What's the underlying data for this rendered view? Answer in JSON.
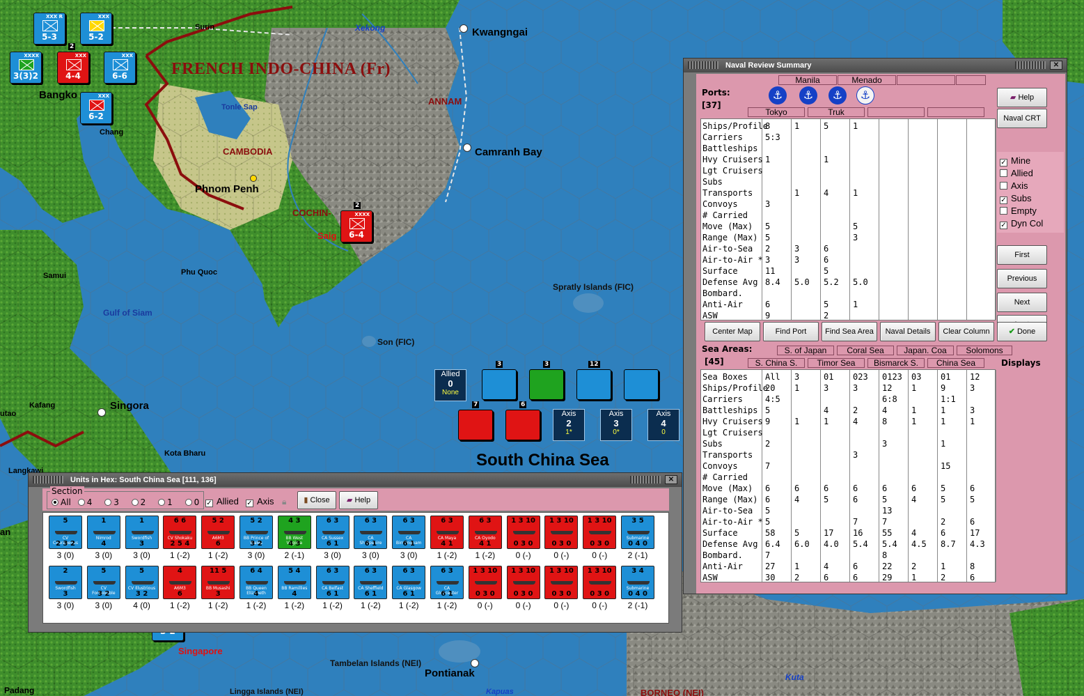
{
  "map": {
    "country_label": "FRENCH INDO-CHINA (Fr)",
    "regions": [
      "ANNAM",
      "CAMBODIA",
      "COCHIN-"
    ],
    "cities": [
      {
        "name": "Surin"
      },
      {
        "name": "Kwangngai"
      },
      {
        "name": "Bangko"
      },
      {
        "name": "Chang"
      },
      {
        "name": "Tonle Sap"
      },
      {
        "name": "Camranh Bay"
      },
      {
        "name": "Phnom Penh"
      },
      {
        "name": "Saig"
      },
      {
        "name": "Phu Quoc"
      },
      {
        "name": "Samui"
      },
      {
        "name": "Spratly Islands (FIC)"
      },
      {
        "name": "Gulf of Siam"
      },
      {
        "name": "Son (FIC)"
      },
      {
        "name": "Kafang"
      },
      {
        "name": "Singora"
      },
      {
        "name": "utao"
      },
      {
        "name": "Kota Bharu"
      },
      {
        "name": "Langkawi"
      },
      {
        "name": "an"
      },
      {
        "name": "Singapore"
      },
      {
        "name": "Tambelan Islands (NEI)"
      },
      {
        "name": "Pontianak"
      },
      {
        "name": "Padang"
      },
      {
        "name": "Lingga Islands (NEI)"
      },
      {
        "name": "BORNEO (NEI)"
      },
      {
        "name": "Kapuas"
      },
      {
        "name": "Kuta"
      },
      {
        "name": "Xekong"
      }
    ],
    "sea_label": "South China Sea",
    "land_counters": [
      {
        "str": "5-3",
        "color": "#1e8fd6",
        "stack": ""
      },
      {
        "str": "5-2",
        "color": "#1e8fd6",
        "stack": ""
      },
      {
        "str": "4-4",
        "color": "#e01414",
        "stack": "2"
      },
      {
        "str": "3(3)2",
        "color": "#1e8fd6",
        "stack": ""
      },
      {
        "str": "6-6",
        "color": "#1e8fd6",
        "stack": ""
      },
      {
        "str": "6-2",
        "color": "#1e8fd6",
        "stack": ""
      },
      {
        "str": "6-4",
        "color": "#e01414",
        "stack": "2"
      },
      {
        "str": "3-2",
        "color": "#1e8fd6",
        "stack": ""
      }
    ],
    "side_boxes": [
      {
        "title": "Allied",
        "num": "0",
        "sub": "None"
      },
      {
        "title": "Axis",
        "num": "2",
        "sub": "1*"
      },
      {
        "title": "Axis",
        "num": "3",
        "sub": "0*"
      },
      {
        "title": "Axis",
        "num": "4",
        "sub": "0"
      }
    ],
    "stack_numbers": [
      "3",
      "3",
      "12",
      "7",
      "6"
    ]
  },
  "naval_review": {
    "title": "Naval Review Summary",
    "ports_label": "Ports:",
    "ports_count": "[37]",
    "ports_top": [
      "Manila",
      "Menado",
      "",
      ""
    ],
    "ports_bottom": [
      "Tokyo",
      "Truk",
      "",
      ""
    ],
    "rows": [
      "Ships/Profile",
      "Carriers",
      "Battleships",
      "Hvy Cruisers",
      "Lgt Cruisers",
      "Subs",
      "Transports",
      "Convoys",
      "# Carried",
      "Move (Max)",
      "Range (Max)",
      "Air-to-Sea",
      "Air-to-Air *",
      "Surface",
      "Defense Avg",
      "Bombard.",
      "Anti-Air",
      "ASW"
    ],
    "port_cols": [
      [
        "8",
        "5:3",
        "",
        "1",
        "",
        "",
        "",
        "3",
        "",
        "5",
        "5",
        "2",
        "3",
        "11",
        "8.4",
        "",
        "6",
        "9"
      ],
      [
        "1",
        "",
        "",
        "",
        "",
        "",
        "1",
        "",
        "",
        "",
        "",
        "3",
        "3",
        "",
        "5.0",
        "",
        "",
        ""
      ],
      [
        "5",
        "",
        "",
        "1",
        "",
        "",
        "4",
        "",
        "",
        "",
        "",
        "6",
        "6",
        "5",
        "5.2",
        "",
        "5",
        "2"
      ],
      [
        "1",
        "",
        "",
        "",
        "",
        "",
        "1",
        "",
        "",
        "5",
        "3",
        "",
        "",
        "",
        "5.0",
        "",
        "1",
        ""
      ],
      [],
      [],
      [],
      []
    ],
    "buttons_mid": [
      "Center Map",
      "Find Port",
      "Find Sea Area",
      "Naval Details",
      "Clear Column"
    ],
    "done_label": "Done",
    "help_label": "Help",
    "naval_crt_label": "Naval CRT",
    "first_label": "First",
    "previous_label": "Previous",
    "next_label": "Next",
    "last_label": "Last",
    "filters": [
      {
        "label": "Mine",
        "checked": true
      },
      {
        "label": "Allied",
        "checked": false
      },
      {
        "label": "Axis",
        "checked": false
      },
      {
        "label": "Subs",
        "checked": true
      },
      {
        "label": "Empty",
        "checked": false
      },
      {
        "label": "Dyn Col",
        "checked": true
      }
    ],
    "sea_areas_label": "Sea Areas:",
    "sea_count": "[45]",
    "sea_top": [
      "S. of Japan",
      "Coral Sea",
      "Japan. Coa",
      "Solomons"
    ],
    "sea_bottom": [
      "S. China S.",
      "Timor Sea",
      "Bismarck S.",
      "China Sea"
    ],
    "displays_label": "Displays",
    "sea_rows": [
      "Sea Boxes",
      "Ships/Profile",
      "Carriers",
      "Battleships",
      "Hvy Cruisers",
      "Lgt Cruisers",
      "Subs",
      "Transports",
      "Convoys",
      "# Carried",
      "Move (Max)",
      "Range (Max)",
      "Air-to-Sea",
      "Air-to-Air *",
      "Surface",
      "Defense Avg",
      "Bombard.",
      "Anti-Air",
      "ASW"
    ],
    "sea_cols": [
      [
        "All",
        "20",
        "4:5",
        "5",
        "9",
        "",
        "2",
        "",
        "7",
        "",
        "6",
        "6",
        "5",
        "5",
        "58",
        "6.4",
        "7",
        "27",
        "30"
      ],
      [
        "3",
        "1",
        "",
        "",
        "1",
        "",
        "",
        "",
        "",
        "",
        "6",
        "4",
        "",
        "",
        "5",
        "6.0",
        "",
        "1",
        "2"
      ],
      [
        "01",
        "3",
        "",
        "4",
        "1",
        "",
        "",
        "",
        "",
        "",
        "6",
        "5",
        "",
        "",
        "17",
        "4.0",
        "",
        "4",
        "6"
      ],
      [
        "023",
        "3",
        "",
        "2",
        "4",
        "",
        "",
        "3",
        "",
        "",
        "6",
        "6",
        "",
        "7",
        "16",
        "5.4",
        "",
        "6",
        "6"
      ],
      [
        "0123",
        "12",
        "6:8",
        "4",
        "8",
        "",
        "3",
        "",
        "",
        "",
        "6",
        "5",
        "13",
        "7",
        "55",
        "5.4",
        "8",
        "22",
        "29"
      ],
      [
        "03",
        "1",
        "",
        "1",
        "1",
        "",
        "",
        "",
        "",
        "",
        "6",
        "4",
        "",
        "",
        "4",
        "4.5",
        "",
        "2",
        "1"
      ],
      [
        "01",
        "9",
        "1:1",
        "1",
        "1",
        "",
        "1",
        "",
        "15",
        "",
        "5",
        "5",
        "",
        "2",
        "6",
        "8.7",
        "",
        "1",
        "2"
      ],
      [
        "12",
        "3",
        "",
        "3",
        "1",
        "",
        "",
        "",
        "",
        "",
        "6",
        "5",
        "",
        "6",
        "17",
        "4.3",
        "",
        "8",
        "6"
      ]
    ]
  },
  "units_window": {
    "title": "Units in Hex: South China Sea [111, 136]",
    "section_label": "Section",
    "radios": [
      "All",
      "4",
      "3",
      "2",
      "1",
      "0"
    ],
    "allied_label": "Allied",
    "axis_label": "Axis",
    "close_label": "Close",
    "help_label": "Help",
    "row1": [
      {
        "name": "CV Courageous",
        "top": "5",
        "bot": "2 3 2",
        "color": "#1e8fd6",
        "label": "3 (0)"
      },
      {
        "name": "Nimrod",
        "top": "1",
        "bot": "4",
        "color": "#1e8fd6",
        "label": "3 (0)"
      },
      {
        "name": "Swordfish",
        "top": "1",
        "bot": "3",
        "color": "#1e8fd6",
        "label": "3 (0)"
      },
      {
        "name": "CV Shokaku",
        "top": "6 6",
        "bot": "2 5 4",
        "color": "#e01414",
        "label": "1 (-2)"
      },
      {
        "name": "A6M3",
        "top": "5 2",
        "bot": "6",
        "color": "#e01414",
        "label": "1 (-2)"
      },
      {
        "name": "BB Prince of Wales",
        "top": "5 2",
        "bot": "3 2",
        "color": "#1e8fd6",
        "label": "3 (0)"
      },
      {
        "name": "BB West Virginia",
        "top": "4 3",
        "bot": "4 3",
        "color": "#1fa31f",
        "label": "2 (-1)"
      },
      {
        "name": "CA Sussex",
        "top": "6 3",
        "bot": "6 1",
        "color": "#1e8fd6",
        "label": "3 (0)"
      },
      {
        "name": "CA Shropshire",
        "top": "6 3",
        "bot": "6 1",
        "color": "#1e8fd6",
        "label": "3 (0)"
      },
      {
        "name": "CA Birmingham",
        "top": "6 3",
        "bot": "6 1",
        "color": "#1e8fd6",
        "label": "3 (0)"
      },
      {
        "name": "CA Maya",
        "top": "6 3",
        "bot": "4 1",
        "color": "#e01414",
        "label": "1 (-2)"
      },
      {
        "name": "CA Oyodo",
        "top": "6 3",
        "bot": "4 1",
        "color": "#e01414",
        "label": "1 (-2)"
      },
      {
        "name": "",
        "top": "1 3 10",
        "bot": "0 3 0",
        "color": "#e01414",
        "label": "0 (-)"
      },
      {
        "name": "",
        "top": "1 3 10",
        "bot": "0 3 0",
        "color": "#e01414",
        "label": "0 (-)"
      },
      {
        "name": "",
        "top": "1 3 10",
        "bot": "0 3 0",
        "color": "#e01414",
        "label": "0 (-)"
      },
      {
        "name": "Submarine",
        "top": "3 5",
        "bot": "0 4 0",
        "color": "#1e8fd6",
        "label": "2 (-1)"
      }
    ],
    "row2": [
      {
        "name": "Swordfish",
        "top": "2",
        "bot": "3",
        "color": "#1e8fd6",
        "label": "3 (0)"
      },
      {
        "name": "CV Formidable",
        "top": "5",
        "bot": "3 2",
        "color": "#1e8fd6",
        "label": "3 (0)"
      },
      {
        "name": "CV Illustrious",
        "top": "5",
        "bot": "3 2",
        "color": "#1e8fd6",
        "label": "4 (0)"
      },
      {
        "name": "A6M3",
        "top": "4",
        "bot": "6",
        "color": "#e01414",
        "label": "1 (-2)"
      },
      {
        "name": "BB Musashi",
        "top": "11 5",
        "bot": "3",
        "color": "#e01414",
        "label": "1 (-2)"
      },
      {
        "name": "BB Queen Elizabeth",
        "top": "6 4",
        "bot": "4",
        "color": "#1e8fd6",
        "label": "1 (-2)"
      },
      {
        "name": "BB Ramillies",
        "top": "5 4",
        "bot": "4",
        "color": "#1e8fd6",
        "label": "1 (-2)"
      },
      {
        "name": "CA Belfast",
        "top": "6 3",
        "bot": "6 1",
        "color": "#1e8fd6",
        "label": "1 (-2)"
      },
      {
        "name": "CA Sheffield",
        "top": "6 3",
        "bot": "6 1",
        "color": "#1e8fd6",
        "label": "1 (-2)"
      },
      {
        "name": "CA Glasgow",
        "top": "6 3",
        "bot": "6 1",
        "color": "#1e8fd6",
        "label": "1 (-2)"
      },
      {
        "name": "CA Gloucester",
        "top": "6 3",
        "bot": "6 1",
        "color": "#1e8fd6",
        "label": "1 (-2)"
      },
      {
        "name": "",
        "top": "1 3 10",
        "bot": "0 3 0",
        "color": "#e01414",
        "label": "0 (-)"
      },
      {
        "name": "",
        "top": "1 3 10",
        "bot": "0 3 0",
        "color": "#e01414",
        "label": "0 (-)"
      },
      {
        "name": "",
        "top": "1 3 10",
        "bot": "0 3 0",
        "color": "#e01414",
        "label": "0 (-)"
      },
      {
        "name": "",
        "top": "1 3 10",
        "bot": "0 3 0",
        "color": "#e01414",
        "label": "0 (-)"
      },
      {
        "name": "Submarine",
        "top": "3 4",
        "bot": "0 4 0",
        "color": "#1e8fd6",
        "label": "2 (-1)"
      }
    ]
  }
}
